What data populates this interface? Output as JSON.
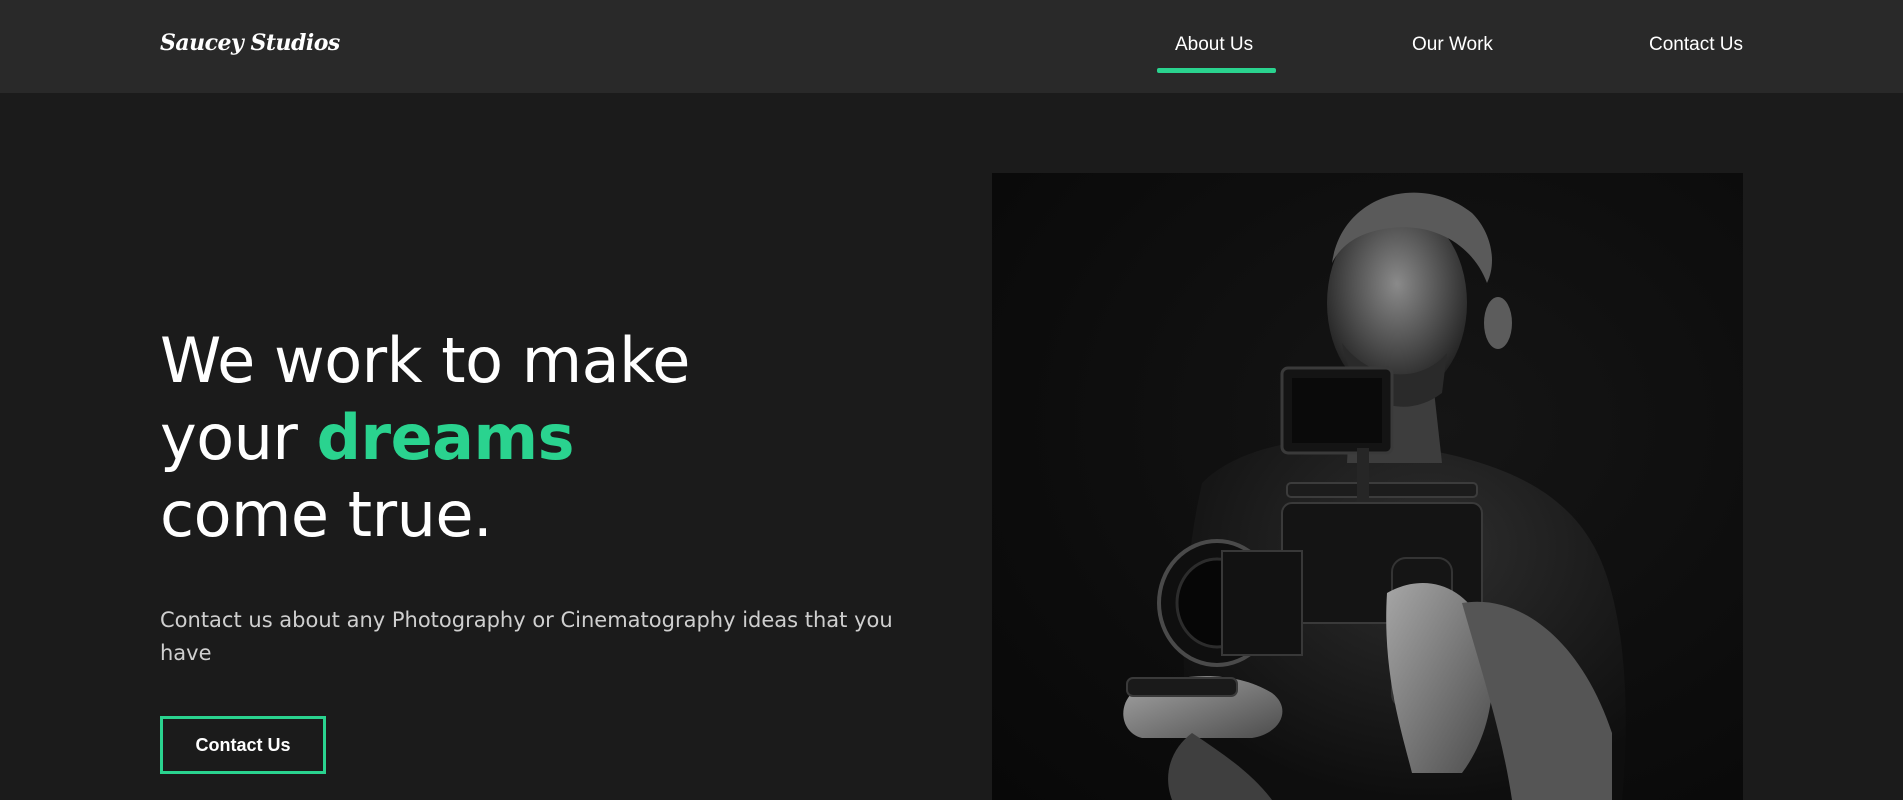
{
  "nav": {
    "logo": "Saucey Studios",
    "links": [
      {
        "label": "About Us",
        "active": true
      },
      {
        "label": "Our Work",
        "active": false
      },
      {
        "label": "Contact Us",
        "active": false
      }
    ]
  },
  "hero": {
    "heading_line1": "We work to make",
    "heading_line2_prefix": "your ",
    "heading_accent": "dreams",
    "heading_line3": "come true.",
    "subtext": "Contact us about any Photography or Cinematography ideas that you have",
    "cta_label": "Contact Us"
  },
  "colors": {
    "accent": "#2ad38f",
    "navbar_bg": "#292929",
    "page_bg": "#1b1b1b",
    "text": "#ffffff"
  },
  "images": {
    "hero_photo": "camera-operator-photo"
  }
}
